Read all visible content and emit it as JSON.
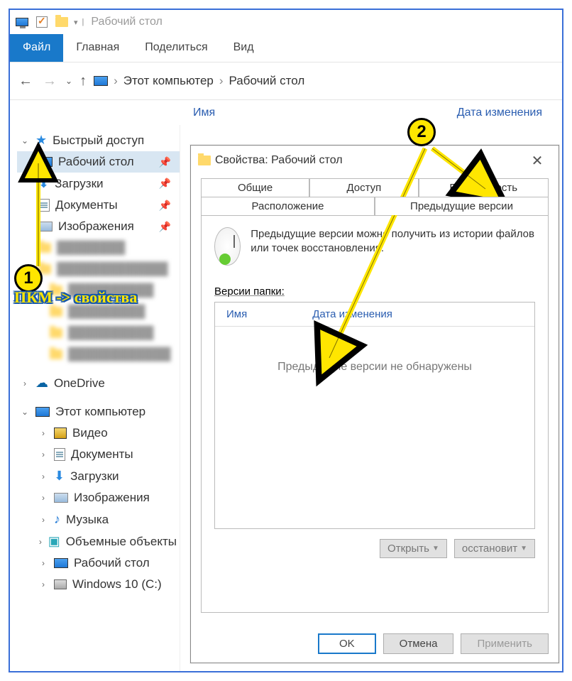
{
  "window": {
    "title": "Рабочий стол"
  },
  "ribbon": {
    "file": "Файл",
    "tabs": [
      "Главная",
      "Поделиться",
      "Вид"
    ]
  },
  "nav": {
    "back": "←",
    "forward": "→",
    "up": "↑",
    "breadcrumb": [
      "Этот компьютер",
      "Рабочий стол"
    ]
  },
  "columns": {
    "name": "Имя",
    "date": "Дата изменения"
  },
  "sidebar": {
    "quick": {
      "label": "Быстрый доступ"
    },
    "quick_items": [
      {
        "label": "Рабочий стол",
        "pinned": true,
        "icon": "desktop"
      },
      {
        "label": "Загрузки",
        "pinned": true,
        "icon": "download"
      },
      {
        "label": "Документы",
        "pinned": true,
        "icon": "document"
      },
      {
        "label": "Изображения",
        "pinned": true,
        "icon": "image"
      }
    ],
    "onedrive": "OneDrive",
    "thispc": "Этот компьютер",
    "thispc_items": [
      {
        "label": "Видео",
        "icon": "video"
      },
      {
        "label": "Документы",
        "icon": "document"
      },
      {
        "label": "Загрузки",
        "icon": "download"
      },
      {
        "label": "Изображения",
        "icon": "image"
      },
      {
        "label": "Музыка",
        "icon": "music"
      },
      {
        "label": "Объемные объекты",
        "icon": "cube"
      },
      {
        "label": "Рабочий стол",
        "icon": "desktop"
      },
      {
        "label": "Windows 10 (C:)",
        "icon": "disk"
      }
    ]
  },
  "dialog": {
    "title": "Свойства: Рабочий стол",
    "tabs_row1": [
      "Общие",
      "Доступ",
      "Безопасность"
    ],
    "tabs_row2": [
      "Расположение",
      "Предыдущие версии"
    ],
    "description": "Предыдущие версии можно получить из истории файлов или точек восстановления.",
    "versions_label": "Версии папки:",
    "list_cols": {
      "name": "Имя",
      "date": "Дата изменения"
    },
    "empty_text": "Предыдущие версии не обнаружены",
    "open_btn": "Открыть",
    "restore_btn": "осстановит",
    "ok": "OK",
    "cancel": "Отмена",
    "apply": "Применить"
  },
  "annotations": {
    "badge1": "1",
    "badge2": "2",
    "text": "ПКМ -> свойства"
  }
}
